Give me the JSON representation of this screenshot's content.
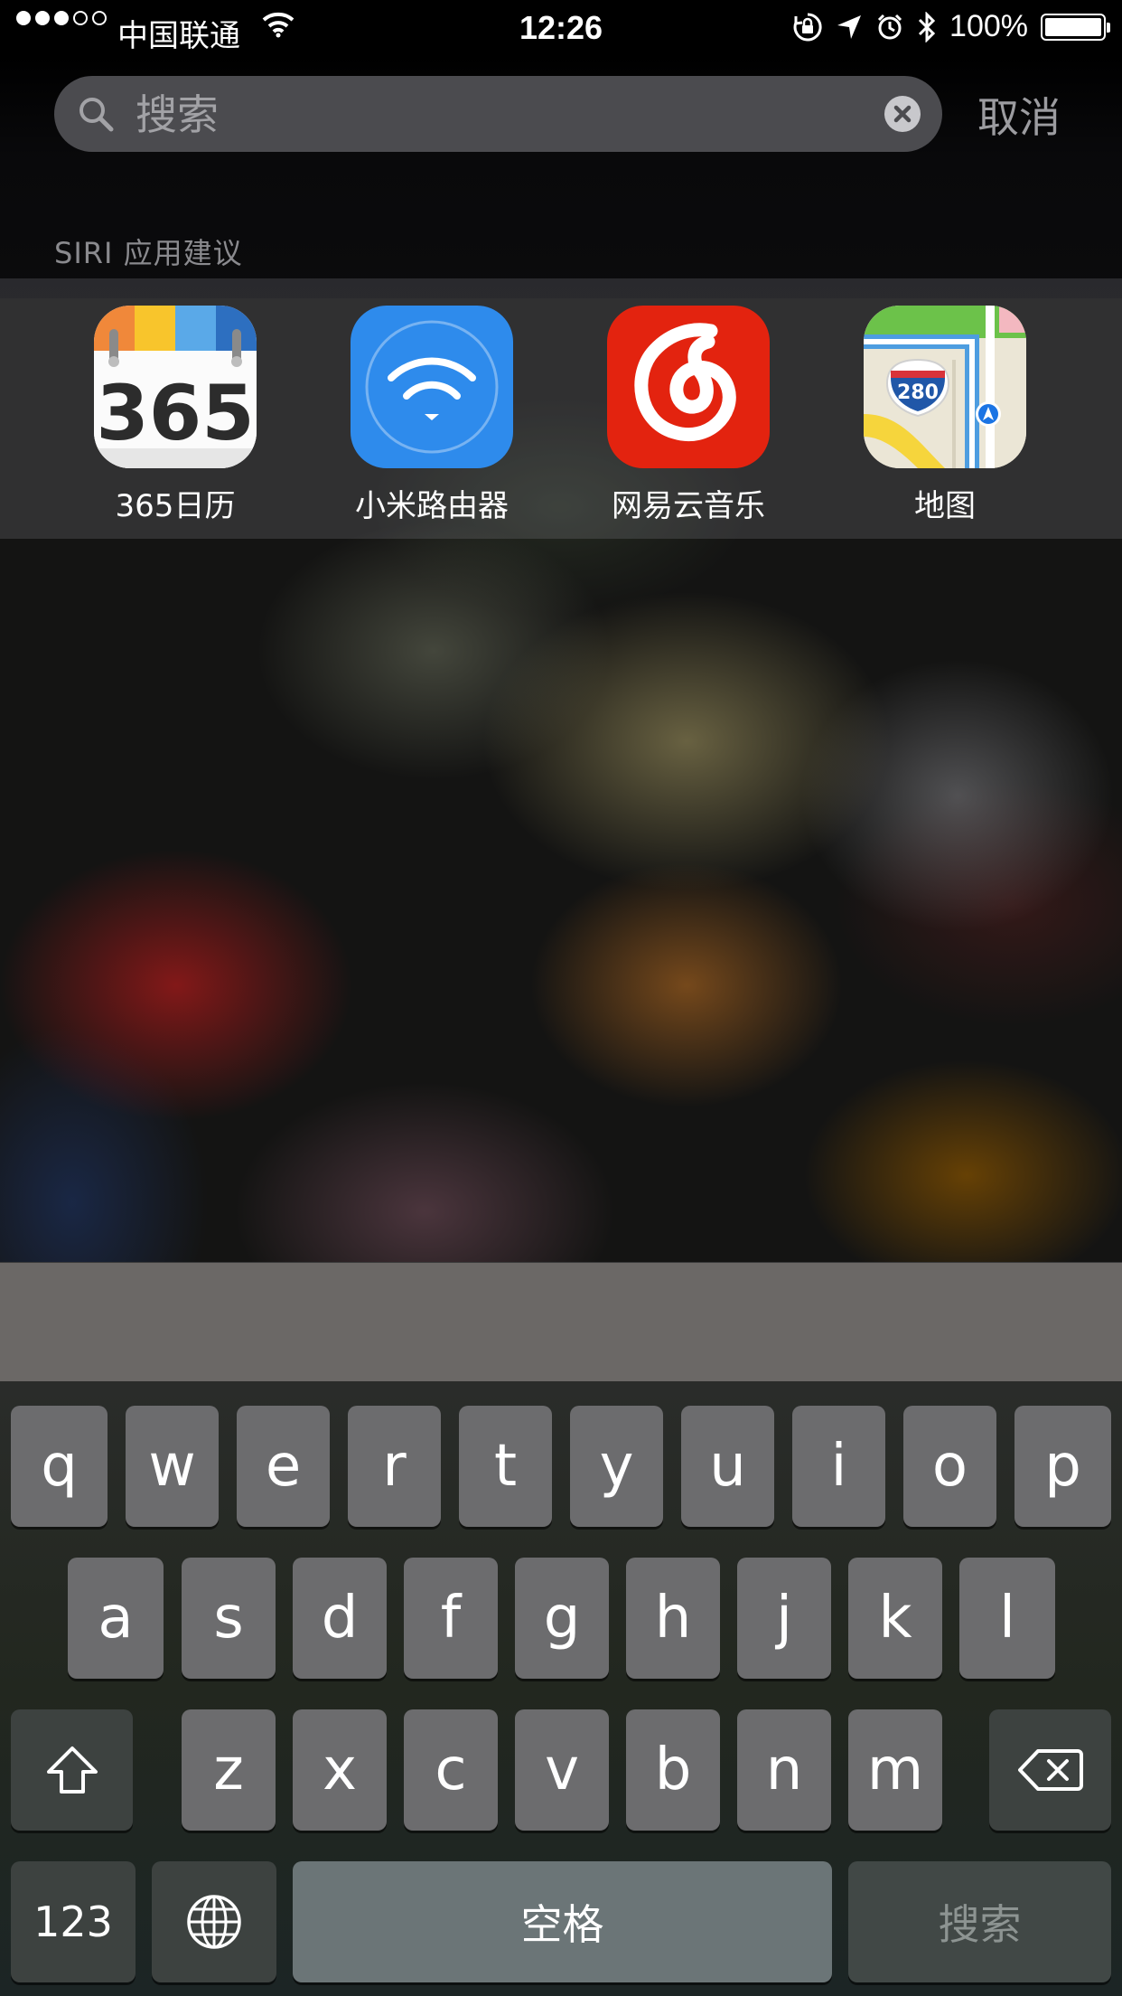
{
  "status_bar": {
    "carrier": "中国联通",
    "time": "12:26",
    "battery": "100%"
  },
  "search": {
    "placeholder": "搜索",
    "cancel_label": "取消"
  },
  "siri_section": {
    "title": "SIRI 应用建议",
    "apps": [
      {
        "label": "365日历",
        "icon": "calendar-365-icon"
      },
      {
        "label": "小米路由器",
        "icon": "mi-router-icon"
      },
      {
        "label": "网易云音乐",
        "icon": "netease-music-icon"
      },
      {
        "label": "地图",
        "icon": "maps-icon"
      }
    ]
  },
  "icon_texts": {
    "calendar": "365",
    "maps_shield": "280"
  },
  "keyboard": {
    "row1": [
      "q",
      "w",
      "e",
      "r",
      "t",
      "y",
      "u",
      "i",
      "o",
      "p"
    ],
    "row2": [
      "a",
      "s",
      "d",
      "f",
      "g",
      "h",
      "j",
      "k",
      "l"
    ],
    "row3": [
      "z",
      "x",
      "c",
      "v",
      "b",
      "n",
      "m"
    ],
    "num_label": "123",
    "space_label": "空格",
    "search_label": "搜索"
  }
}
